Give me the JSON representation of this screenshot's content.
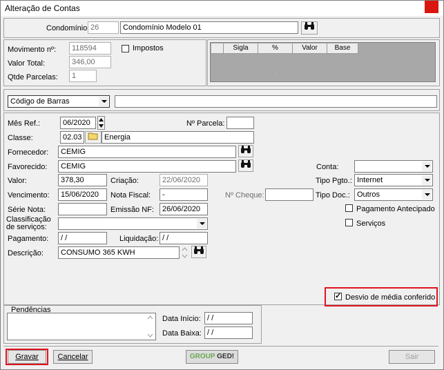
{
  "window": {
    "title": "Alteração de Contas"
  },
  "condominio": {
    "label": "Condomínio:",
    "code": "26",
    "name": "Condomínio Modelo 01"
  },
  "movimento": {
    "numero_label": "Movimento nº:",
    "numero": "118594",
    "valor_total_label": "Valor Total:",
    "valor_total": "346,00",
    "parcelas_label": "Qtde Parcelas:",
    "parcelas": "1",
    "impostos_label": "Impostos"
  },
  "impostos_grid": {
    "columns": [
      "Sigla",
      "%",
      "Valor",
      "Base"
    ],
    "empty_marker": "."
  },
  "barcode": {
    "type": "Código de Barras",
    "value": ""
  },
  "form": {
    "mes_ref_label": "Mês Ref.:",
    "mes_ref": "06/2020",
    "parcela_label": "Nº Parcela:",
    "parcela": "",
    "classe_label": "Classe:",
    "classe_code": "02.03",
    "classe_name": "Energia",
    "fornecedor_label": "Fornecedor:",
    "fornecedor": "CEMIG",
    "favorecido_label": "Favorecido:",
    "favorecido": "CEMIG",
    "conta_label": "Conta:",
    "conta": "",
    "valor_label": "Valor:",
    "valor": "378,30",
    "criacao_label": "Criação:",
    "criacao": "22/06/2020",
    "tipo_pgto_label": "Tipo Pgto.:",
    "tipo_pgto": "Internet",
    "vencimento_label": "Vencimento:",
    "vencimento": "15/06/2020",
    "nota_fiscal_label": "Nota Fiscal:",
    "nota_fiscal": "-",
    "cheque_label": "Nº Cheque:",
    "cheque": "",
    "tipo_doc_label": "Tipo Doc.:",
    "tipo_doc": "Outros",
    "serie_nota_label": "Série Nota:",
    "serie_nota": "",
    "emissao_label": "Emissão NF:",
    "emissao": "26/06/2020",
    "pagamento_antecipado_label": "Pagamento Antecipado",
    "classificacao_label_1": "Classificação",
    "classificacao_label_2": "de serviços:",
    "classificacao": "",
    "servicos_label": "Serviços",
    "pagamento_label": "Pagamento:",
    "pagamento": " / /",
    "liquidacao_label": "Liquidação:",
    "liquidacao": " / /",
    "descricao_label": "Descrição:",
    "descricao": "CONSUMO 365 KWH",
    "desvio_label": "Desvio de média conferido"
  },
  "pendencias": {
    "label": "Pendências",
    "data_inicio_label": "Data Início:",
    "data_inicio": " / /",
    "data_baixa_label": "Data Baixa:",
    "data_baixa": " / /"
  },
  "buttons": {
    "gravar": "Gravar",
    "cancelar": "Cancelar",
    "sair": "Sair"
  },
  "logo": {
    "group": "GROUP",
    "ged": "GED!"
  },
  "colors": {
    "highlight": "#e0141e",
    "close": "#d9160f"
  }
}
